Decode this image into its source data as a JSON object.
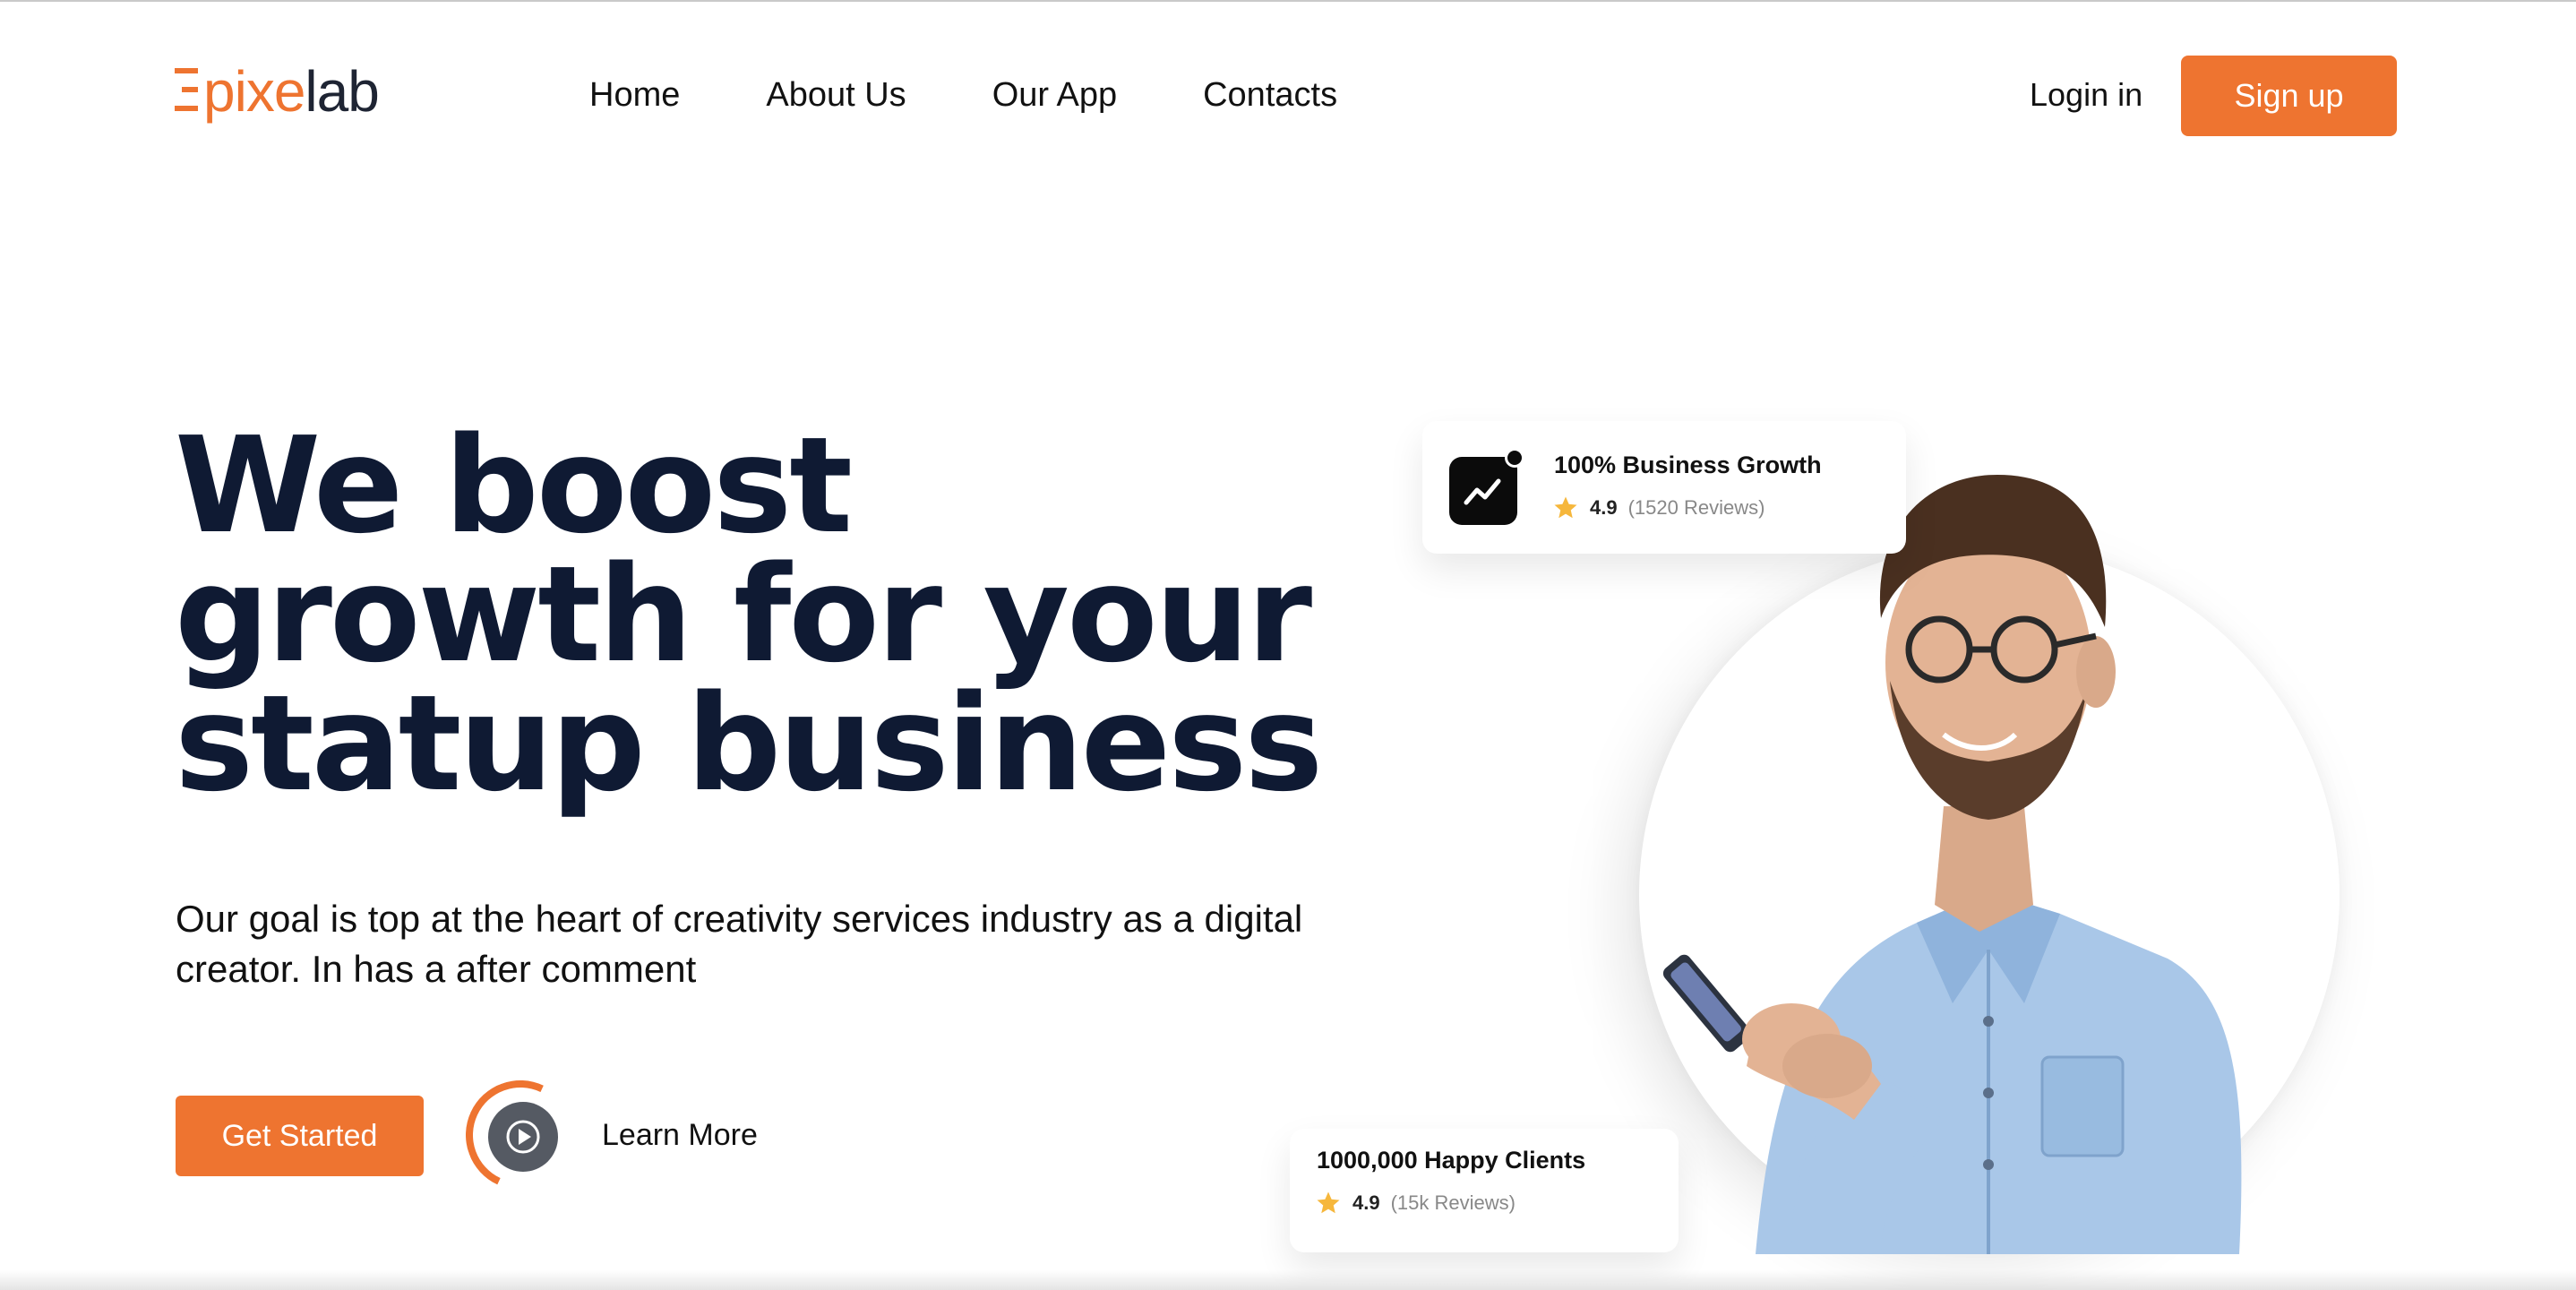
{
  "brand": {
    "logo_orange": "pixe",
    "logo_dark": "lab",
    "accent_color": "#ee7430",
    "text_color": "#0f1a33"
  },
  "nav": {
    "items": [
      {
        "label": "Home"
      },
      {
        "label": "About Us"
      },
      {
        "label": "Our App"
      },
      {
        "label": "Contacts"
      }
    ],
    "login_label": "Login in",
    "signup_label": "Sign up"
  },
  "hero": {
    "title_lines": [
      "We boost",
      "growth for your",
      "statup business"
    ],
    "subtitle": "Our goal is top at the heart of creativity services industry as a digital creator. In has a after comment",
    "cta_label": "Get Started",
    "learn_more_label": "Learn More"
  },
  "cards": [
    {
      "title": "100% Business Growth",
      "rating": "4.9",
      "reviews": "(1520 Reviews)",
      "icon": "trending-up-icon"
    },
    {
      "title": "1000,000 Happy Clients",
      "rating": "4.9",
      "reviews": "(15k Reviews)",
      "icon": "star-icon"
    }
  ]
}
